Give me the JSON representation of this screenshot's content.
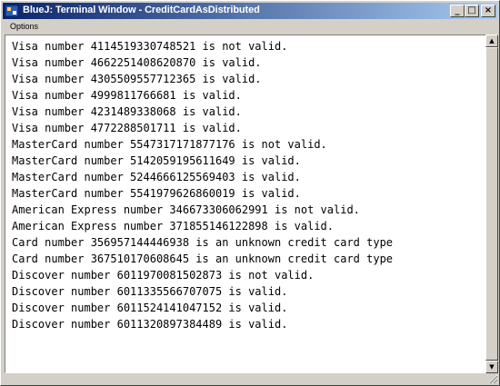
{
  "window": {
    "title": "BlueJ: Terminal Window - CreditCardAsDistributed",
    "icon": "bluej-app-icon",
    "controls": {
      "minimize": "_",
      "maximize": "□",
      "close": "×"
    }
  },
  "menubar": {
    "items": [
      {
        "label": "Options"
      }
    ]
  },
  "terminal": {
    "lines": [
      "Visa number 4114519330748521 is not valid.",
      "Visa number 4662251408620870 is valid.",
      "Visa number 4305509557712365 is valid.",
      "Visa number 4999811766681 is valid.",
      "Visa number 4231489338068 is valid.",
      "Visa number 4772288501711 is valid.",
      "MasterCard number 5547317171877176 is not valid.",
      "MasterCard number 5142059195611649 is valid.",
      "MasterCard number 5244666125569403 is valid.",
      "MasterCard number 5541979626860019 is valid.",
      "American Express number 346673306062991 is not valid.",
      "American Express number 371855146122898 is valid.",
      "Card number 356957144446938 is an unknown credit card type",
      "Card number 367510170608645 is an unknown credit card type",
      "Discover number 6011970081502873 is not valid.",
      "Discover number 6011335566707075 is valid.",
      "Discover number 6011524141047152 is valid.",
      "Discover number 6011320897384489 is valid."
    ]
  },
  "scrollbar": {
    "up_arrow": "▲",
    "down_arrow": "▼"
  },
  "colors": {
    "title_gradient_start": "#0a246a",
    "title_gradient_end": "#a6caf0",
    "chrome": "#d4d0c8"
  }
}
